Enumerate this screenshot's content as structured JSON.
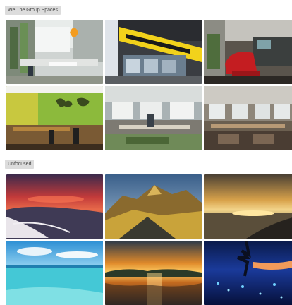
{
  "sections": [
    {
      "label": "We The Group Spaces",
      "tiles": [
        {
          "name": "office-space-1"
        },
        {
          "name": "office-space-2"
        },
        {
          "name": "office-space-3"
        },
        {
          "name": "office-space-4"
        },
        {
          "name": "office-space-5"
        },
        {
          "name": "office-space-6"
        }
      ]
    },
    {
      "label": "Unfocused",
      "tiles": [
        {
          "name": "landscape-1"
        },
        {
          "name": "landscape-2"
        },
        {
          "name": "landscape-3"
        },
        {
          "name": "landscape-4"
        },
        {
          "name": "landscape-5"
        },
        {
          "name": "landscape-6"
        }
      ]
    }
  ]
}
